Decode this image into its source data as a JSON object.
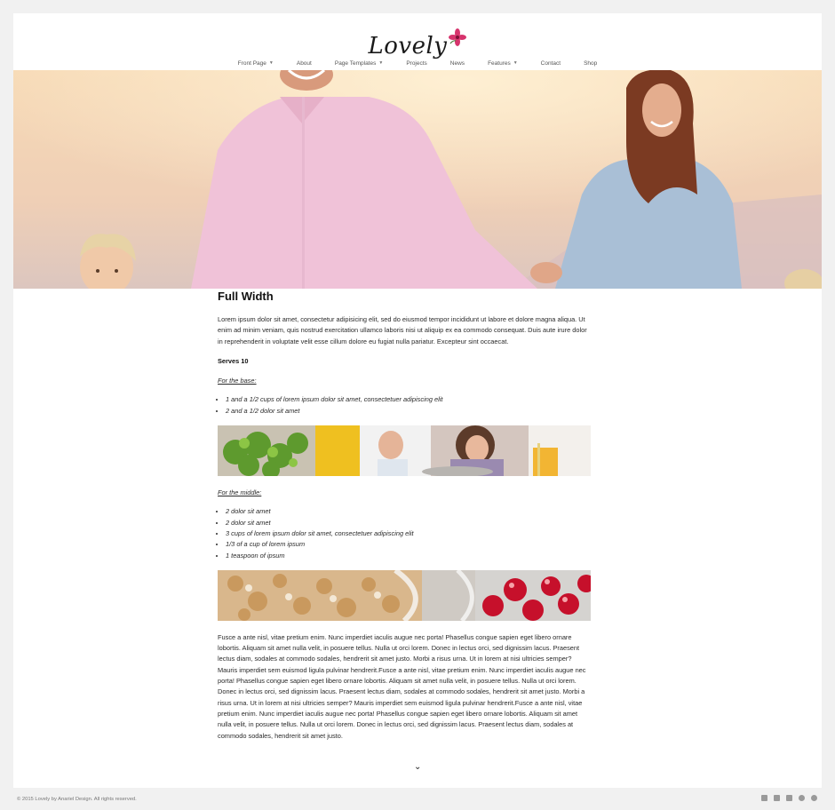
{
  "site": {
    "logo_text": "Lovely",
    "nav": [
      {
        "label": "Front Page",
        "dropdown": true
      },
      {
        "label": "About",
        "dropdown": false
      },
      {
        "label": "Page Templates",
        "dropdown": true
      },
      {
        "label": "Projects",
        "dropdown": false
      },
      {
        "label": "News",
        "dropdown": false
      },
      {
        "label": "Features",
        "dropdown": true
      },
      {
        "label": "Contact",
        "dropdown": false
      },
      {
        "label": "Shop",
        "dropdown": false
      }
    ]
  },
  "article": {
    "title": "Full Width",
    "intro": "Lorem ipsum dolor sit amet, consectetur adipisicing elit, sed do eiusmod tempor incididunt ut labore et dolore magna aliqua. Ut enim ad minim veniam, quis nostrud exercitation ullamco laboris nisi ut aliquip ex ea commodo consequat. Duis aute irure dolor in reprehenderit in voluptate velit esse cillum dolore eu fugiat nulla pariatur. Excepteur sint occaecat.",
    "serves": "Serves 10",
    "base_heading": "For the base:",
    "base_items": [
      "1 and a 1/2 cups of lorem ipsum dolor sit amet, consectetuer adipiscing elit",
      "2 and a 1/2 dolor sit amet"
    ],
    "middle_heading": "For the middle:",
    "middle_items": [
      "2 dolor sit amet",
      "2 dolor sit amet",
      "3 cups of lorem ipsum dolor sit amet, consectetuer adipiscing elit",
      "1/3 of a cup of lorem ipsum",
      "1 teaspoon of ipsum"
    ],
    "body": "Fusce a ante nisl, vitae pretium enim. Nunc imperdiet iaculis augue nec porta! Phasellus congue sapien eget libero ornare lobortis. Aliquam sit amet nulla velit, in posuere tellus. Nulla ut orci lorem. Donec in lectus orci, sed dignissim lacus. Praesent lectus diam, sodales at commodo sodales, hendrerit sit amet justo. Morbi a risus urna. Ut in lorem at nisi ultricies semper? Mauris imperdiet sem euismod ligula pulvinar hendrerit.Fusce a ante nisl, vitae pretium enim. Nunc imperdiet iaculis augue nec porta! Phasellus congue sapien eget libero ornare lobortis. Aliquam sit amet nulla velit, in posuere tellus. Nulla ut orci lorem. Donec in lectus orci, sed dignissim lacus. Praesent lectus diam, sodales at commodo sodales, hendrerit sit amet justo. Morbi a risus urna. Ut in lorem at nisi ultricies semper? Mauris imperdiet sem euismod ligula pulvinar hendrerit.Fusce a ante nisl, vitae pretium enim. Nunc imperdiet iaculis augue nec porta! Phasellus congue sapien eget libero ornare lobortis. Aliquam sit amet nulla velit, in posuere tellus. Nulla ut orci lorem. Donec in lectus orci, sed dignissim lacus. Praesent lectus diam, sodales at commodo sodales, hendrerit sit amet justo."
  },
  "footer": {
    "copyright": "© 2015 Lovely by Anariel Design. All rights reserved.",
    "social_icons": [
      "facebook-icon",
      "twitter-icon",
      "google-plus-icon",
      "pinterest-icon",
      "wordpress-icon"
    ]
  },
  "colors": {
    "page_bg": "#f1f1f1",
    "content_bg": "#ffffff",
    "logo_flower": "#d6336c"
  }
}
